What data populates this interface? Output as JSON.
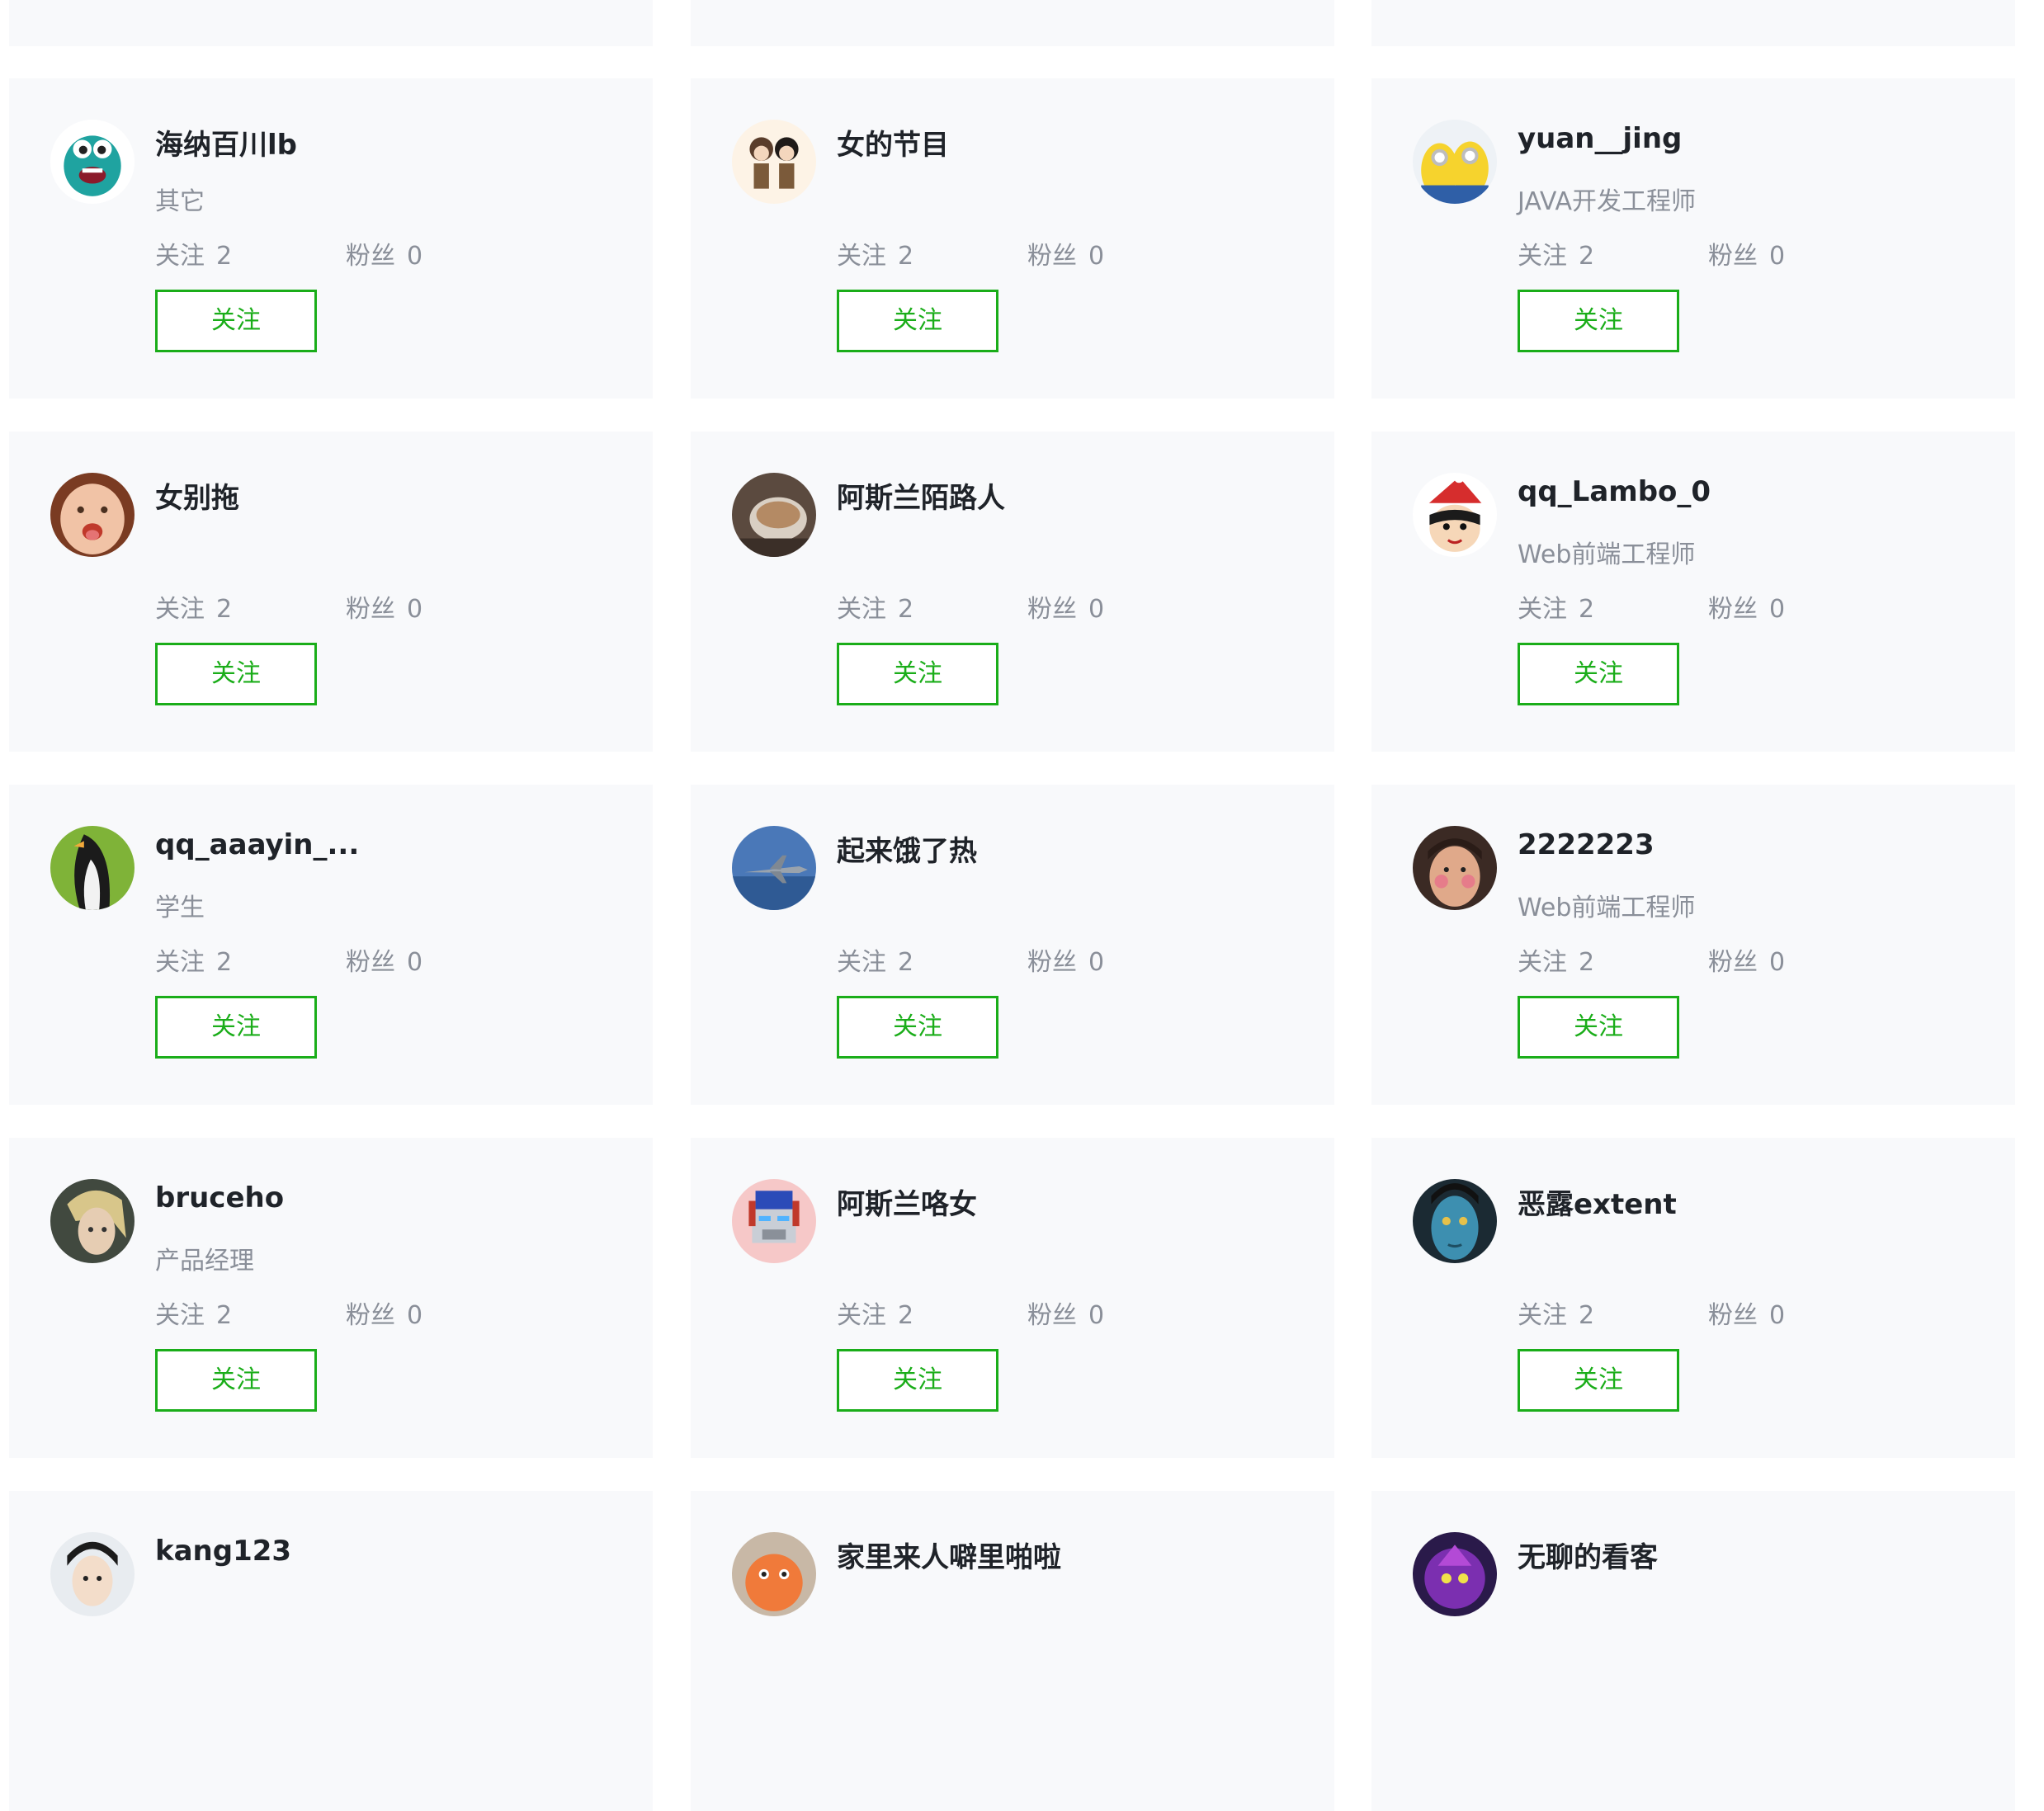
{
  "button_label": "关注",
  "follow_label": "关注",
  "fans_label": "粉丝",
  "colors": {
    "accent": "#1aad19",
    "card_bg": "#f8f9fb",
    "name": "#1f2329",
    "muted": "#8a8f99"
  },
  "users": [
    {
      "name": "海纳百川lb",
      "desc": "其它",
      "following": "2",
      "fans": "0",
      "avatar_icon": "monster-avatar-icon"
    },
    {
      "name": "女的节目",
      "desc": "",
      "following": "2",
      "fans": "0",
      "avatar_icon": "anime-couple-avatar-icon"
    },
    {
      "name": "yuan__jing",
      "desc": "JAVA开发工程师",
      "following": "2",
      "fans": "0",
      "avatar_icon": "minions-avatar-icon"
    },
    {
      "name": "女别拖",
      "desc": "",
      "following": "2",
      "fans": "0",
      "avatar_icon": "child-face-avatar-icon"
    },
    {
      "name": "阿斯兰陌路人",
      "desc": "",
      "following": "2",
      "fans": "0",
      "avatar_icon": "coffee-cup-avatar-icon"
    },
    {
      "name": "qq_Lambo_0",
      "desc": "Web前端工程师",
      "following": "2",
      "fans": "0",
      "avatar_icon": "santa-hat-cartoon-avatar-icon"
    },
    {
      "name": "qq_aaayin_...",
      "desc": "学生",
      "following": "2",
      "fans": "0",
      "avatar_icon": "penguin-avatar-icon"
    },
    {
      "name": "起来饿了热",
      "desc": "",
      "following": "2",
      "fans": "0",
      "avatar_icon": "fighter-jet-avatar-icon"
    },
    {
      "name": "2222223",
      "desc": "Web前端工程师",
      "following": "2",
      "fans": "0",
      "avatar_icon": "man-face-avatar-icon"
    },
    {
      "name": "bruceho",
      "desc": "产品经理",
      "following": "2",
      "fans": "0",
      "avatar_icon": "blonde-character-avatar-icon"
    },
    {
      "name": "阿斯兰咯女",
      "desc": "",
      "following": "2",
      "fans": "0",
      "avatar_icon": "robot-avatar-icon"
    },
    {
      "name": "恶露extent",
      "desc": "",
      "following": "2",
      "fans": "0",
      "avatar_icon": "avatar-blue-face-icon"
    },
    {
      "name": "kang123",
      "desc": "",
      "following": "",
      "fans": "",
      "avatar_icon": "anime-soldier-avatar-icon"
    },
    {
      "name": "家里来人噼里啪啦",
      "desc": "",
      "following": "",
      "fans": "",
      "avatar_icon": "cartoon-face-avatar-icon"
    },
    {
      "name": "无聊的看客",
      "desc": "",
      "following": "",
      "fans": "",
      "avatar_icon": "purple-creature-avatar-icon"
    }
  ]
}
